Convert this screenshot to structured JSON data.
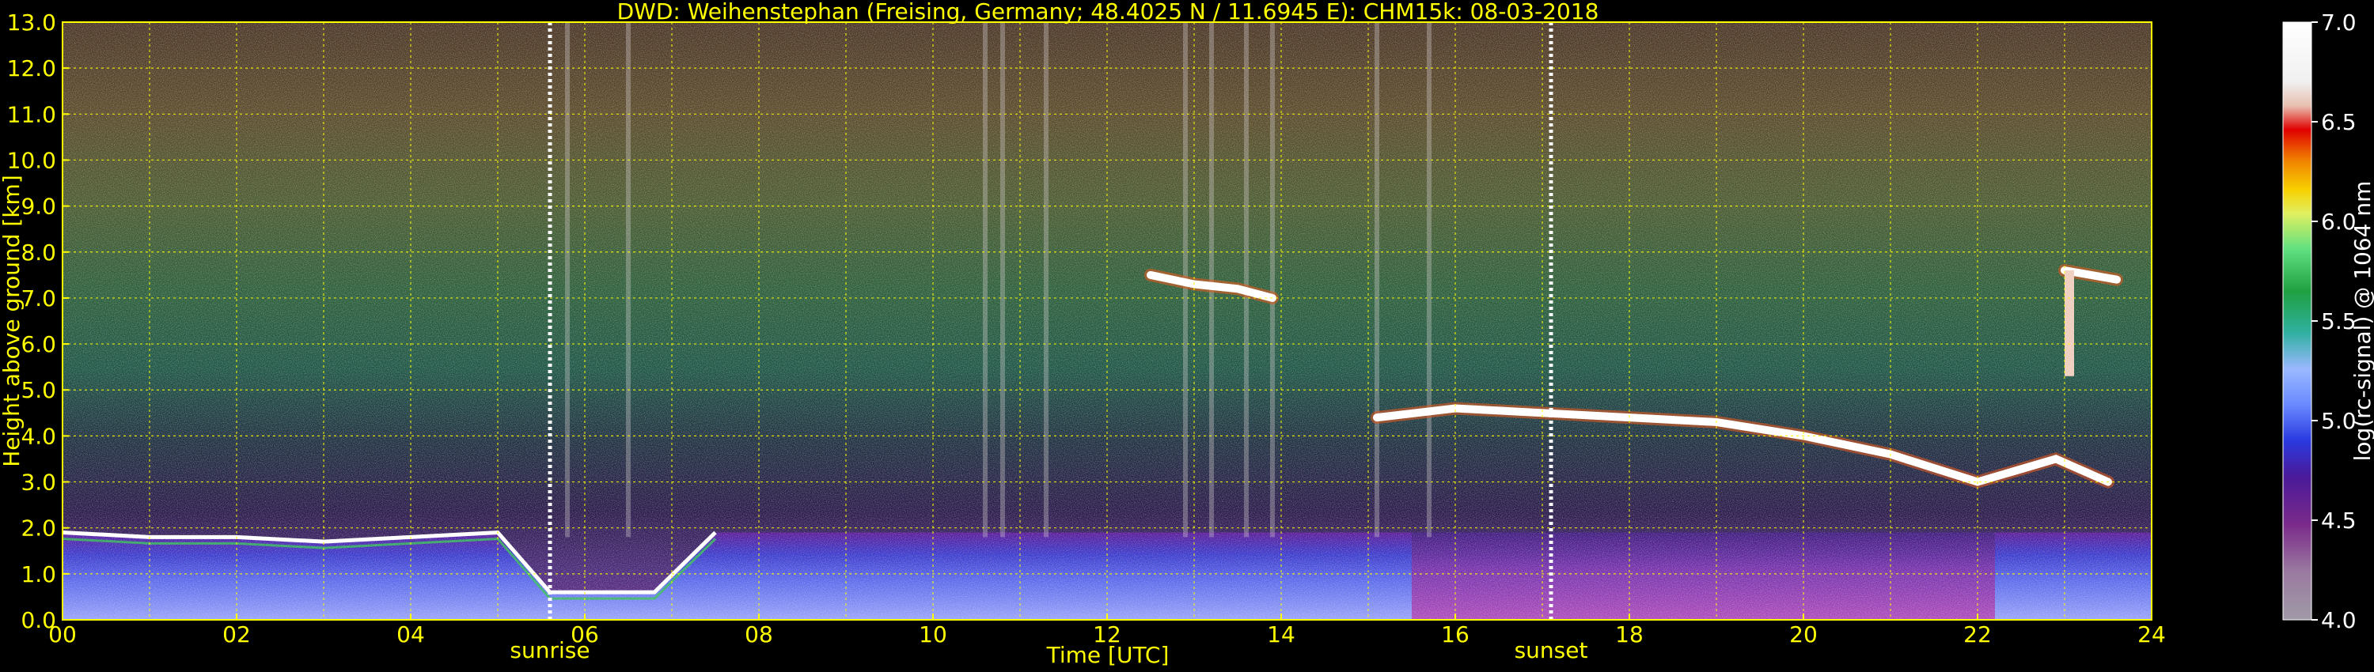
{
  "chart_data": {
    "type": "heatmap",
    "title": "DWD: Weihenstephan (Freising, Germany; 48.4025 N / 11.6945 E):    CHM15k: 08-03-2018",
    "xlabel": "Time [UTC]",
    "ylabel": "Height above ground [km]",
    "xlim": [
      0,
      24
    ],
    "ylim": [
      0,
      13
    ],
    "x_ticks": [
      "00",
      "02",
      "04",
      "06",
      "08",
      "10",
      "12",
      "14",
      "16",
      "18",
      "20",
      "22",
      "24"
    ],
    "y_ticks": [
      "0.0",
      "1.0",
      "2.0",
      "3.0",
      "4.0",
      "5.0",
      "6.0",
      "7.0",
      "8.0",
      "9.0",
      "10.0",
      "11.0",
      "12.0",
      "13.0"
    ],
    "grid": true,
    "colorbar": {
      "label": "log(rc-signal) @ 1064 nm",
      "range": [
        4.0,
        7.0
      ],
      "ticks": [
        "4.0",
        "4.5",
        "5.0",
        "5.5",
        "6.0",
        "6.5",
        "7.0"
      ]
    },
    "markers": [
      {
        "label": "sunrise",
        "time": 5.6
      },
      {
        "label": "sunset",
        "time": 17.1
      }
    ],
    "features": [
      {
        "kind": "boundary-layer-top",
        "t": [
          0,
          1,
          2,
          3,
          4,
          5,
          5.6,
          6.8,
          7.5
        ],
        "h": [
          1.9,
          1.8,
          1.8,
          1.7,
          1.8,
          1.9,
          0.6,
          0.6,
          1.9
        ]
      },
      {
        "kind": "cloud-layer",
        "t": [
          12.5,
          13.0,
          13.5,
          13.9
        ],
        "h": [
          7.5,
          7.3,
          7.2,
          7.0
        ]
      },
      {
        "kind": "cloud-layer",
        "t": [
          15.1,
          16,
          17,
          18,
          19,
          20,
          21,
          22,
          22.9,
          23.5
        ],
        "h": [
          4.4,
          4.6,
          4.5,
          4.4,
          4.3,
          4.0,
          3.6,
          3.0,
          3.5,
          3.0
        ]
      },
      {
        "kind": "cloud-layer",
        "t": [
          23.0,
          23.3,
          23.6
        ],
        "h": [
          7.6,
          7.5,
          7.4
        ]
      }
    ],
    "vertical_streaks": [
      5.8,
      6.5,
      10.6,
      10.8,
      11.3,
      12.9,
      13.2,
      13.6,
      13.9,
      15.1,
      15.7
    ]
  }
}
